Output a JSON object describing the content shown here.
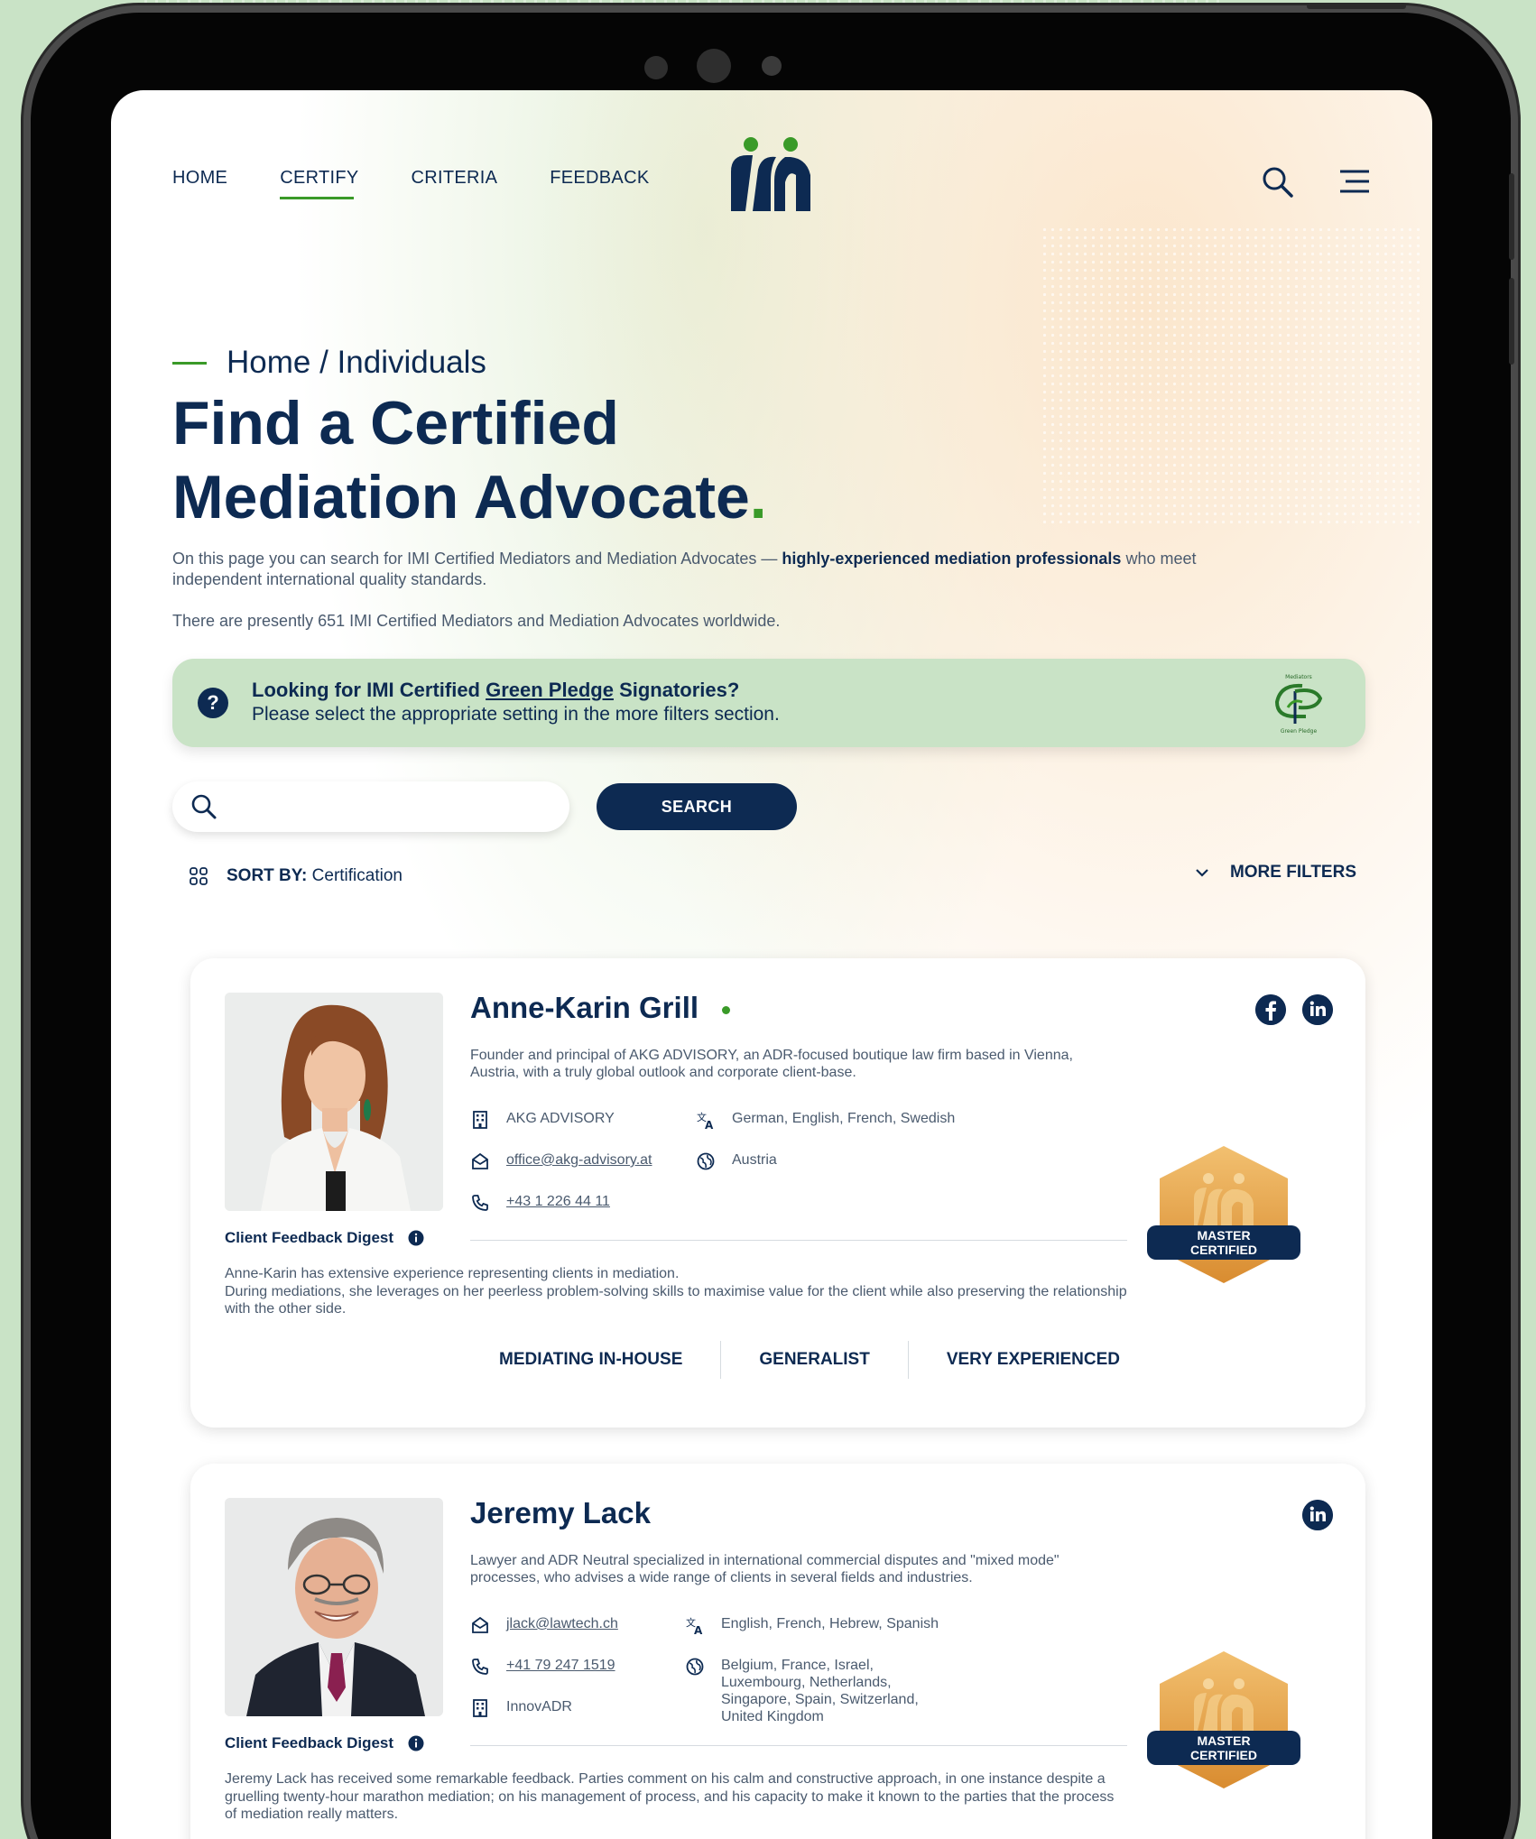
{
  "nav": {
    "items": [
      "HOME",
      "CERTIFY",
      "CRITERIA",
      "FEEDBACK"
    ],
    "active": "CERTIFY"
  },
  "header": {
    "logo_text": "imi"
  },
  "breadcrumb": "Home / Individuals",
  "title": {
    "line1": "Find a Certified",
    "line2": "Mediation Advocate",
    "dot": "."
  },
  "intro": {
    "part1": "On this page you can search for IMI Certified Mediators and Mediation Advocates — ",
    "bold": "highly-experienced mediation professionals",
    "part2": " who meet independent international quality standards."
  },
  "count_text": "There are presently 651 IMI Certified Mediators and Mediation Advocates worldwide.",
  "banner": {
    "pre": "Looking for IMI Certified ",
    "link": "Green Pledge",
    "post": " Signatories?",
    "sub": "Please select the appropriate setting in the more filters section.",
    "icon_top": "Mediators",
    "icon_bottom": "Green Pledge"
  },
  "search": {
    "placeholder": "",
    "button": "SEARCH"
  },
  "sort": {
    "label": "SORT BY:",
    "value": "Certification"
  },
  "filters": {
    "label": "MORE FILTERS"
  },
  "profiles": [
    {
      "name": "Anne-Karin Grill",
      "bio": "Founder and principal of AKG ADVISORY, an ADR-focused boutique law firm based in Vienna, Austria, with a truly global outlook and corporate client-base.",
      "org": "AKG ADVISORY",
      "languages": "German, English, French, Swedish",
      "email": "office@akg-advisory.at",
      "country": "Austria",
      "phone": "+43 1 226 44 11",
      "badge": {
        "line1": "MASTER",
        "line2": "CERTIFIED"
      },
      "digest_label": "Client Feedback Digest",
      "digest": "Anne-Karin has extensive experience representing clients in mediation.\nDuring mediations, she leverages on her peerless problem-solving skills to maximise value for the client while also preserving the relationship with the other side.",
      "tags": [
        "MEDIATING IN-HOUSE",
        "GENERALIST",
        "VERY EXPERIENCED"
      ]
    },
    {
      "name": "Jeremy Lack",
      "bio": "Lawyer and ADR Neutral specialized in international commercial disputes and \"mixed mode\" processes, who advises a wide range of clients in several fields and industries.",
      "email": "jlack@lawtech.ch",
      "languages": "English, French, Hebrew, Spanish",
      "phone": "+41 79 247 1519",
      "countries": "Belgium, France, Israel, Luxembourg, Netherlands, Singapore, Spain, Switzerland, United Kingdom",
      "org": "InnovADR",
      "badge": {
        "line1": "MASTER",
        "line2": "CERTIFIED"
      },
      "digest_label": "Client Feedback Digest",
      "digest": "Jeremy Lack has received some remarkable feedback. Parties comment on his calm and constructive approach, in one instance despite a gruelling twenty-hour marathon mediation; on his management of process, and his capacity to make it known to the parties that the process of mediation really matters."
    }
  ],
  "colors": {
    "navy": "#0d2a52",
    "green": "#3a9a28",
    "banner": "#c9e3c6",
    "gold": "#e0a84e"
  }
}
